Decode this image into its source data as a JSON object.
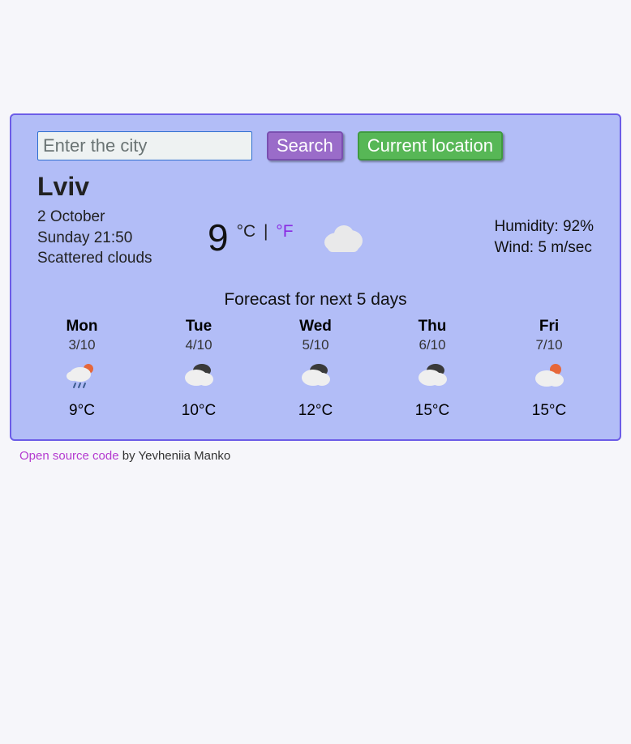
{
  "search": {
    "placeholder": "Enter the city",
    "search_label": "Search",
    "location_label": "Current location"
  },
  "current": {
    "city": "Lviv",
    "date": "2 October",
    "daytime": "Sunday 21:50",
    "condition": "Scattered clouds",
    "temp": "9",
    "unit_c": "°C",
    "unit_f": "°F",
    "humidity_label": "Humidity: 92%",
    "wind_label": "Wind: 5 m/sec"
  },
  "forecast_title": "Forecast for next 5 days",
  "forecast": [
    {
      "day": "Mon",
      "date": "3/10",
      "temp": "9°C",
      "icon": "rain-sun"
    },
    {
      "day": "Tue",
      "date": "4/10",
      "temp": "10°C",
      "icon": "cloudy-dark"
    },
    {
      "day": "Wed",
      "date": "5/10",
      "temp": "12°C",
      "icon": "cloudy-dark"
    },
    {
      "day": "Thu",
      "date": "6/10",
      "temp": "15°C",
      "icon": "cloudy-dark"
    },
    {
      "day": "Fri",
      "date": "7/10",
      "temp": "15°C",
      "icon": "cloud-sun"
    }
  ],
  "footer": {
    "link_text": "Open source code",
    "by_text": " by Yevheniia Manko"
  }
}
